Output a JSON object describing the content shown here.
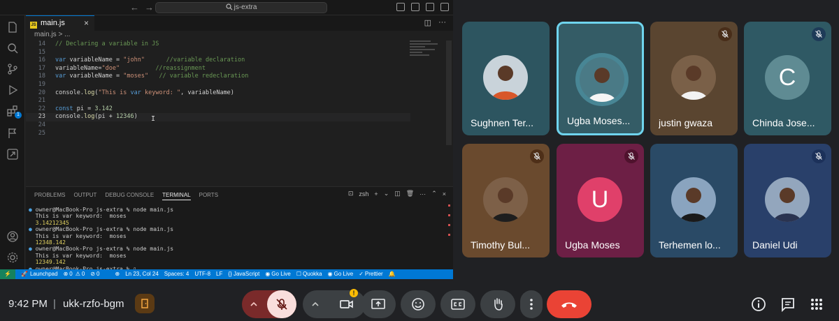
{
  "vscode": {
    "search_text": "js-extra",
    "tab_label": "main.js",
    "breadcrumb": "main.js > ...",
    "code_lines": [
      {
        "num": "14",
        "text": "// Declaring a variable in JS"
      },
      {
        "num": "15",
        "text": ""
      },
      {
        "num": "16",
        "text": "var variableName = \"john\"      //variable declaration"
      },
      {
        "num": "17",
        "text": "variableName=\"doe\"          //reassignment"
      },
      {
        "num": "18",
        "text": "var variableName = \"moses\"   // variable redeclaration"
      },
      {
        "num": "19",
        "text": ""
      },
      {
        "num": "20",
        "text": "console.log(\"This is var keyword: \", variableName)"
      },
      {
        "num": "21",
        "text": ""
      },
      {
        "num": "22",
        "text": "const pi = 3.142"
      },
      {
        "num": "23",
        "text": "console.log(pi + 12346)"
      },
      {
        "num": "24",
        "text": ""
      },
      {
        "num": "25",
        "text": ""
      }
    ],
    "panel_tabs": [
      "PROBLEMS",
      "OUTPUT",
      "DEBUG CONSOLE",
      "TERMINAL",
      "PORTS"
    ],
    "terminal_shell": "zsh",
    "terminal_lines": [
      {
        "text": "owner@MacBook-Pro js-extra % node main.js",
        "prompt": true
      },
      {
        "text": "This is var keyword:  moses",
        "prompt": false
      },
      {
        "text": "3.14212345",
        "prompt": false
      },
      {
        "text": "owner@MacBook-Pro js-extra % node main.js",
        "prompt": true
      },
      {
        "text": "This is var keyword:  moses",
        "prompt": false
      },
      {
        "text": "12348.142",
        "prompt": false
      },
      {
        "text": "owner@MacBook-Pro js-extra % node main.js",
        "prompt": true
      },
      {
        "text": "This is var keyword:  moses",
        "prompt": false
      },
      {
        "text": "12349.142",
        "prompt": false
      },
      {
        "text": "owner@MacBook-Pro js-extra % ",
        "prompt": true
      }
    ],
    "status": {
      "launchpad": "Launchpad",
      "errors": "0",
      "warnings": "0",
      "ports": "0",
      "position": "Ln 23, Col 24",
      "spaces": "Spaces: 4",
      "encoding": "UTF-8",
      "eol": "LF",
      "language": "{} JavaScript",
      "golive1": "Go Live",
      "quokka": "Quokka",
      "golive2": "Go Live",
      "prettier": "Prettier"
    }
  },
  "participants": [
    {
      "name": "Sughnen Ter...",
      "muted": false,
      "avatar_type": "photo",
      "bg": "#2d5560"
    },
    {
      "name": "Ugba Moses...",
      "muted": false,
      "avatar_type": "photo",
      "bg": "#345c66",
      "speaking": true
    },
    {
      "name": "justin gwaza",
      "muted": true,
      "avatar_type": "photo",
      "bg": "#5a4530"
    },
    {
      "name": "Chinda Jose...",
      "muted": true,
      "avatar_type": "letter",
      "letter": "C",
      "bg": "#2f5964"
    },
    {
      "name": "Timothy Bul...",
      "muted": true,
      "avatar_type": "photo",
      "bg": "#6a4a2e"
    },
    {
      "name": "Ugba Moses",
      "muted": true,
      "avatar_type": "letter",
      "letter": "U",
      "bg": "#6d1f45"
    },
    {
      "name": "Terhemen lo...",
      "muted": false,
      "avatar_type": "photo",
      "bg": "#2a4a66"
    },
    {
      "name": "Daniel Udi",
      "muted": true,
      "avatar_type": "photo",
      "bg": "#29406a"
    }
  ],
  "meeting": {
    "time": "9:42 PM",
    "separator": "|",
    "code": "ukk-rzfo-bgm",
    "warning_mark": "!"
  },
  "colors": {
    "accent_blue": "#0078d4",
    "end_call_red": "#ea4335",
    "speaker_ring": "#6fd4ee",
    "mic_off_bg": "#f9dedc"
  }
}
